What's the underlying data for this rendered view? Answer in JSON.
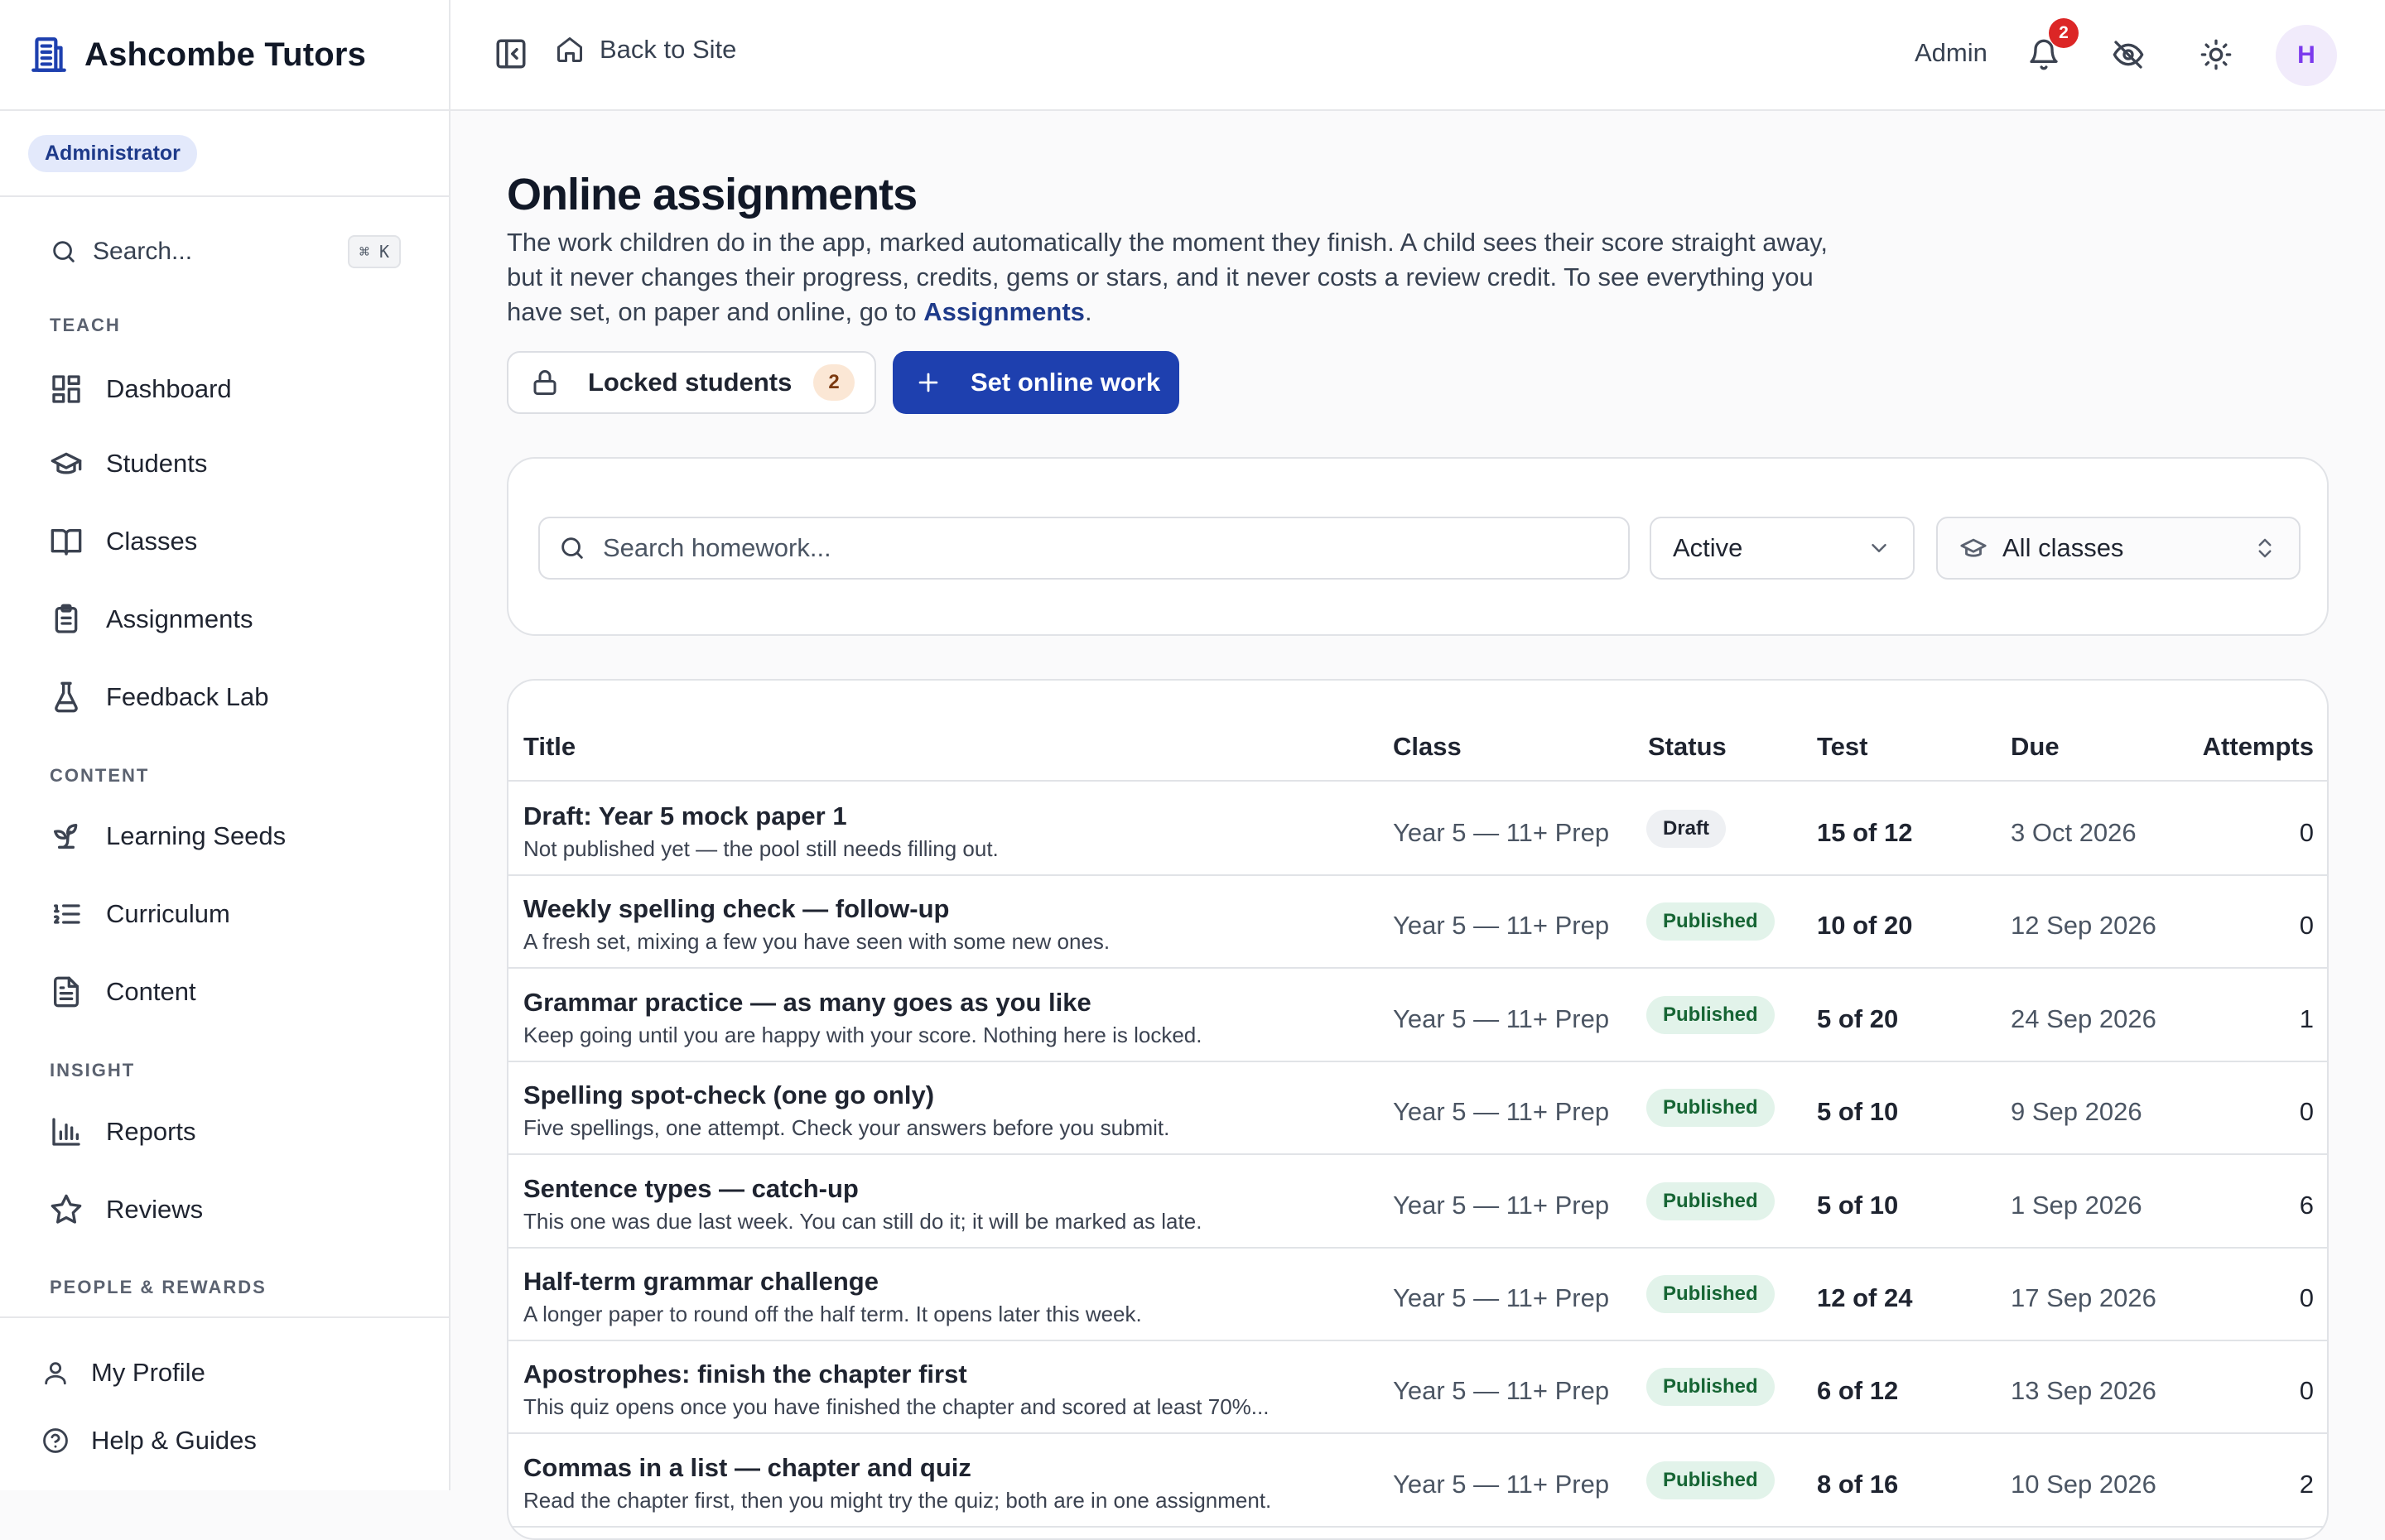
{
  "brand": {
    "name": "Ashcombe Tutors",
    "icon": "building-icon"
  },
  "role_badge": "Administrator",
  "sidebar": {
    "search_label": "Search...",
    "search_shortcut": "⌘ K",
    "sections": [
      {
        "heading": "TEACH",
        "items": [
          {
            "label": "Dashboard",
            "icon": "dashboard-icon"
          },
          {
            "label": "Students",
            "icon": "graduation-cap-icon"
          },
          {
            "label": "Classes",
            "icon": "book-open-icon"
          },
          {
            "label": "Assignments",
            "icon": "clipboard-icon"
          },
          {
            "label": "Feedback Lab",
            "icon": "flask-icon"
          }
        ]
      },
      {
        "heading": "CONTENT",
        "items": [
          {
            "label": "Learning Seeds",
            "icon": "sprout-icon"
          },
          {
            "label": "Curriculum",
            "icon": "list-ordered-icon"
          },
          {
            "label": "Content",
            "icon": "file-text-icon"
          }
        ]
      },
      {
        "heading": "INSIGHT",
        "items": [
          {
            "label": "Reports",
            "icon": "bar-chart-icon"
          },
          {
            "label": "Reviews",
            "icon": "star-icon"
          }
        ]
      },
      {
        "heading": "PEOPLE & REWARDS",
        "items": []
      }
    ],
    "bottom": [
      {
        "label": "My Profile",
        "icon": "user-icon"
      },
      {
        "label": "Help & Guides",
        "icon": "help-circle-icon"
      }
    ]
  },
  "header": {
    "back_label": "Back to Site",
    "admin_label": "Admin",
    "notification_count": "2",
    "avatar_initial": "H"
  },
  "page": {
    "title": "Online assignments",
    "desc_text": "The work children do in the app, marked automatically the moment they finish. A child sees their score straight away, but it never changes their progress, credits, gems or stars, and it never costs a review credit. To see everything you have set, on paper and online, go to ",
    "desc_link": "Assignments",
    "desc_end": ".",
    "locked_label": "Locked students",
    "locked_count": "2",
    "set_work_label": "Set online work"
  },
  "filters": {
    "search_placeholder": "Search homework...",
    "status_value": "Active",
    "class_value": "All classes"
  },
  "table": {
    "columns": {
      "title": "Title",
      "class": "Class",
      "status": "Status",
      "test": "Test",
      "due": "Due",
      "attempts": "Attempts"
    },
    "rows": [
      {
        "title": "Draft: Year 5 mock paper 1",
        "subtitle": "Not published yet — the pool still needs filling out.",
        "class": "Year 5 — 11+ Prep",
        "status": "Draft",
        "test": "15 of 12",
        "due": "3 Oct 2026",
        "attempts": "0"
      },
      {
        "title": "Weekly spelling check — follow-up",
        "subtitle": "A fresh set, mixing a few you have seen with some new ones.",
        "class": "Year 5 — 11+ Prep",
        "status": "Published",
        "test": "10 of 20",
        "due": "12 Sep 2026",
        "attempts": "0"
      },
      {
        "title": "Grammar practice — as many goes as you like",
        "subtitle": "Keep going until you are happy with your score. Nothing here is locked.",
        "class": "Year 5 — 11+ Prep",
        "status": "Published",
        "test": "5 of 20",
        "due": "24 Sep 2026",
        "attempts": "1"
      },
      {
        "title": "Spelling spot-check (one go only)",
        "subtitle": "Five spellings, one attempt. Check your answers before you submit.",
        "class": "Year 5 — 11+ Prep",
        "status": "Published",
        "test": "5 of 10",
        "due": "9 Sep 2026",
        "attempts": "0"
      },
      {
        "title": "Sentence types — catch-up",
        "subtitle": "This one was due last week. You can still do it; it will be marked as late.",
        "class": "Year 5 — 11+ Prep",
        "status": "Published",
        "test": "5 of 10",
        "due": "1 Sep 2026",
        "attempts": "6"
      },
      {
        "title": "Half-term grammar challenge",
        "subtitle": "A longer paper to round off the half term. It opens later this week.",
        "class": "Year 5 — 11+ Prep",
        "status": "Published",
        "test": "12 of 24",
        "due": "17 Sep 2026",
        "attempts": "0"
      },
      {
        "title": "Apostrophes: finish the chapter first",
        "subtitle": "This quiz opens once you have finished the chapter and scored at least 70%...",
        "class": "Year 5 — 11+ Prep",
        "status": "Published",
        "test": "6 of 12",
        "due": "13 Sep 2026",
        "attempts": "0"
      },
      {
        "title": "Commas in a list — chapter and quiz",
        "subtitle": "Read the chapter first, then you might try the quiz; both are in one assignment.",
        "class": "Year 5 — 11+ Prep",
        "status": "Published",
        "test": "8 of 16",
        "due": "10 Sep 2026",
        "attempts": "2"
      }
    ]
  },
  "colors": {
    "primary": "#1e40af",
    "draft_badge": "#eef0f3",
    "published_badge": "#e2f3ea",
    "notification": "#dc2626"
  }
}
